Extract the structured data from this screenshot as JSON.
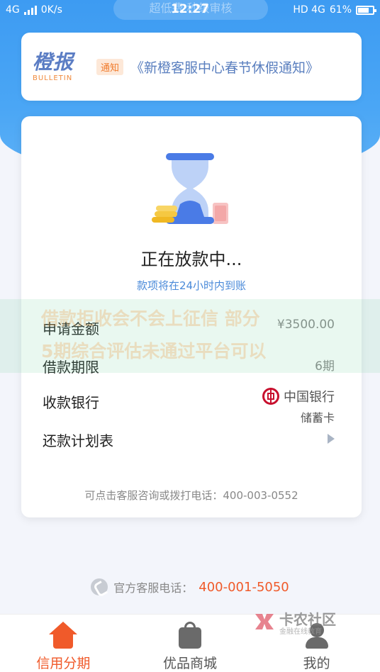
{
  "status_bar": {
    "network": "4G",
    "speed": "0K/s",
    "time": "12:27",
    "right_network": "HD 4G",
    "battery": "61%",
    "ghost_banner": "超低费 秒级审核"
  },
  "bulletin": {
    "logo_cn": "橙报",
    "logo_en": "BULLETIN",
    "tag": "通知",
    "notice": "《新橙客服中心春节休假通知》"
  },
  "loan_status": {
    "title": "正在放款中...",
    "subtitle": "款项将在24小时内到账"
  },
  "details": {
    "amount_label": "申请金额",
    "amount_value": "¥3500.00",
    "term_label": "借款期限",
    "term_value": "6期",
    "bank_label": "收款银行",
    "bank_name": "中国银行",
    "card_type": "储蓄卡",
    "plan_label": "还款计划表"
  },
  "hint": "可点击客服咨询或拨打电话：400-003-0552",
  "overlay": {
    "line1": "借款拒收会不会上征信 部分",
    "line2": "5期综合评估未通过平台可以"
  },
  "hotline": {
    "label": "官方客服电话：",
    "number": "400-001-5050"
  },
  "tabs": [
    {
      "label": "信用分期",
      "icon": "home-icon"
    },
    {
      "label": "优品商城",
      "icon": "shopping-bag-icon"
    },
    {
      "label": "我的",
      "icon": "user-icon"
    }
  ],
  "watermark": {
    "name": "卡农社区",
    "tagline": "金融在线教育"
  },
  "colors": {
    "primary_blue": "#3d9bf2",
    "accent_orange": "#f05a2a",
    "bank_red": "#c8102e"
  }
}
